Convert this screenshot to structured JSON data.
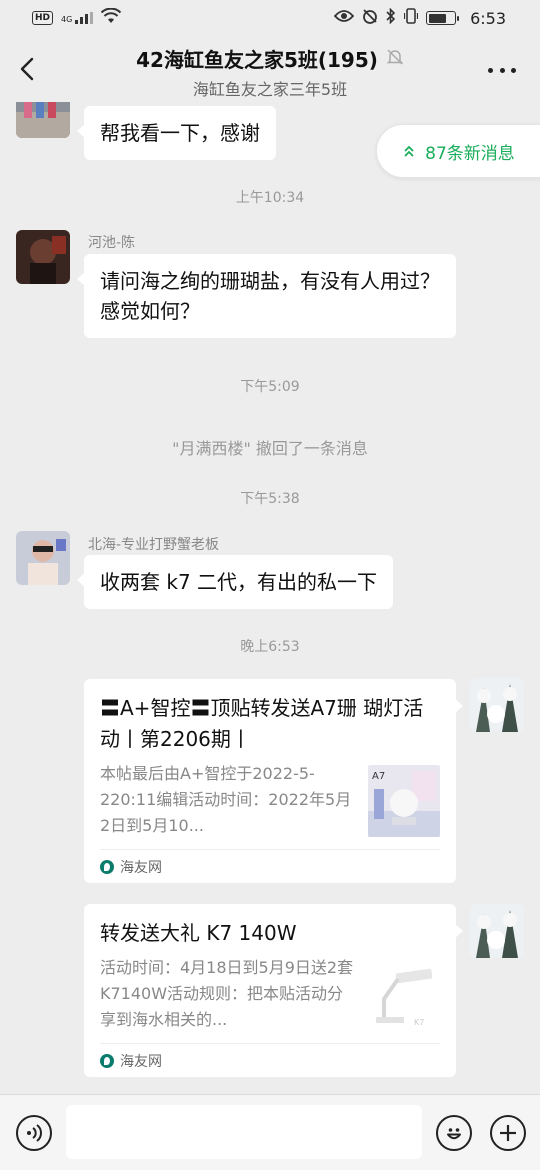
{
  "status_bar": {
    "hd": "HD",
    "network": "4G",
    "time": "6:53"
  },
  "header": {
    "title": "42海缸鱼友之家5班(195)",
    "subtitle": "海缸鱼友之家三年5班"
  },
  "new_messages": {
    "label": "87条新消息"
  },
  "messages": {
    "m1": {
      "text": "帮我看一下，感谢"
    },
    "t1": "上午10:34",
    "m2": {
      "sender": "河池-陈",
      "text": "请问海之绚的珊瑚盐，有没有人用过？感觉如何？"
    },
    "t2": "下午5:09",
    "recall": "\"月满西楼\" 撤回了一条消息",
    "t3": "下午5:38",
    "m3": {
      "sender": "北海-专业打野蟹老板",
      "text": "收两套 k7 二代，有出的私一下"
    },
    "t4": "晚上6:53",
    "card1": {
      "title": "〓A+智控〓顶贴转发送A7珊 瑚灯活动丨第2206期丨",
      "desc": "本帖最后由A+智控于2022-5-220:11编辑活动时间：2022年5月2日到5月10...",
      "source": "海友网",
      "thumb_text": "A7"
    },
    "card2": {
      "title": "转发送大礼 K7 140W",
      "desc": "活动时间：4月18日到5月9日送2套K7140W活动规则：把本贴活动分享到海水相关的...",
      "source": "海友网"
    }
  },
  "input": {
    "placeholder": ""
  }
}
